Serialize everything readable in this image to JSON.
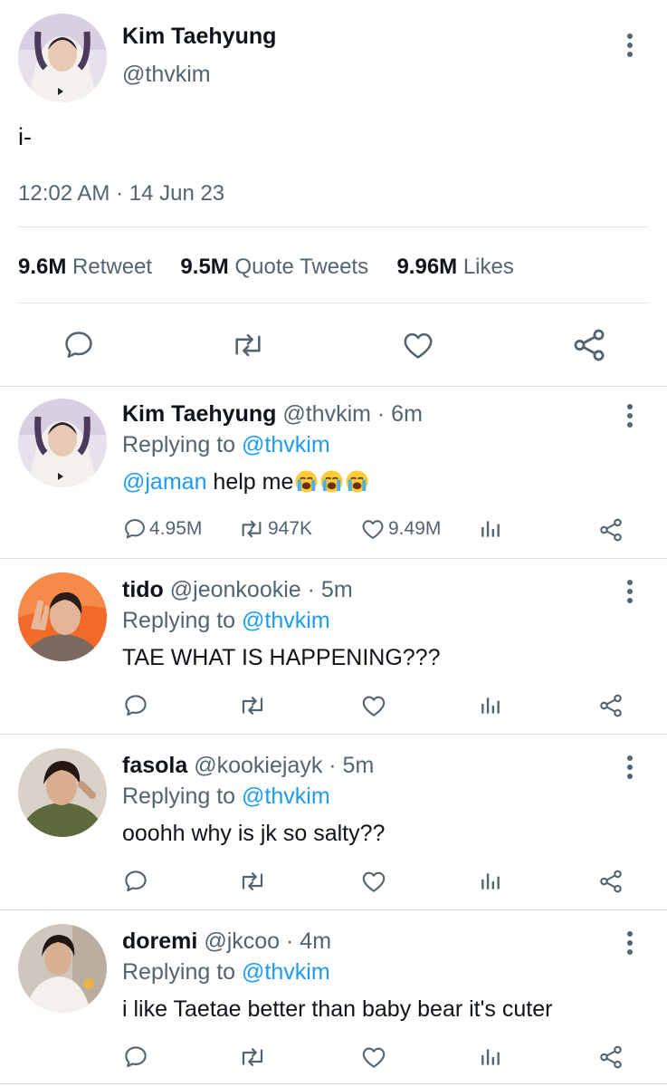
{
  "main_tweet": {
    "author_name": "Kim Taehyung",
    "author_handle": "@thvkim",
    "text": "i-",
    "timestamp": "12:02 AM · 14 Jun 23",
    "stats": {
      "retweets_count": "9.6M",
      "retweets_label": "Retweet",
      "quotes_count": "9.5M",
      "quotes_label": "Quote Tweets",
      "likes_count": "9.96M",
      "likes_label": "Likes"
    },
    "actions": [
      "reply-icon",
      "retweet-icon",
      "like-icon",
      "share-icon"
    ]
  },
  "replies": [
    {
      "name": "Kim Taehyung",
      "handle": "@thvkim",
      "time": "· 6m",
      "replying_prefix": "Replying to",
      "replying_to": "@thvkim",
      "mention": "@jaman",
      "text": " help me",
      "emoji": "loudly-crying-face ×3",
      "reply_count": "4.95M",
      "retweet_count": "947K",
      "like_count": "9.49M"
    },
    {
      "name": "tido",
      "handle": "@jeonkookie",
      "time": "· 5m",
      "replying_prefix": "Replying to",
      "replying_to": "@thvkim",
      "text": "TAE WHAT IS HAPPENING???"
    },
    {
      "name": "fasola",
      "handle": "@kookiejayk",
      "time": "· 5m",
      "replying_prefix": "Replying to",
      "replying_to": "@thvkim",
      "text": "ooohh why is jk so salty??"
    },
    {
      "name": "doremi",
      "handle": "@jkcoo",
      "time": "· 4m",
      "replying_prefix": "Replying to",
      "replying_to": "@thvkim",
      "text": "i like Taetae better than baby bear it's cuter"
    }
  ],
  "colors": {
    "text": "#0f1419",
    "muted": "#536471",
    "link": "#1d9bf0",
    "divider": "#d9dee2"
  }
}
